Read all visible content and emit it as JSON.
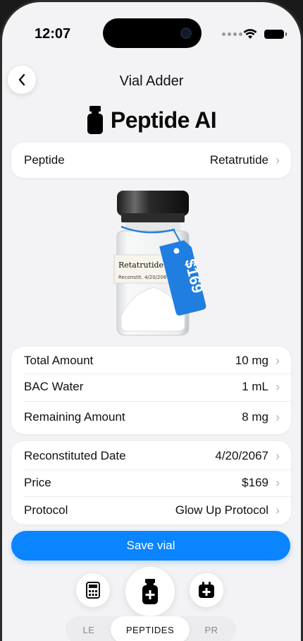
{
  "status_bar": {
    "time": "12:07"
  },
  "nav": {
    "title": "Vial Adder"
  },
  "brand": {
    "name": "Peptide AI"
  },
  "peptide_row": {
    "label": "Peptide",
    "value": "Retatrutide"
  },
  "vial_image": {
    "label_name": "Retatrutide",
    "label_note": "Reconstit. 4/20/2067",
    "price_tag": "$169"
  },
  "amounts": [
    {
      "label": "Total Amount",
      "value": "10 mg"
    },
    {
      "label": "BAC Water",
      "value": "1 mL"
    },
    {
      "label": "Remaining Amount",
      "value": "8 mg"
    }
  ],
  "details": [
    {
      "label": "Reconstituted Date",
      "value": "4/20/2067"
    },
    {
      "label": "Price",
      "value": "$169"
    },
    {
      "label": "Protocol",
      "value": "Glow Up Protocol"
    }
  ],
  "actions": {
    "save_label": "Save vial"
  },
  "bottom_icons": [
    "calculator-icon",
    "add-vial-icon",
    "add-calendar-icon"
  ],
  "tabs": [
    {
      "label": "LE",
      "active": false
    },
    {
      "label": "PEPTIDES",
      "active": true
    },
    {
      "label": "PR",
      "active": false
    }
  ],
  "colors": {
    "accent": "#0a84ff",
    "tag": "#1f7ee0",
    "background": "#f3f3f5"
  }
}
